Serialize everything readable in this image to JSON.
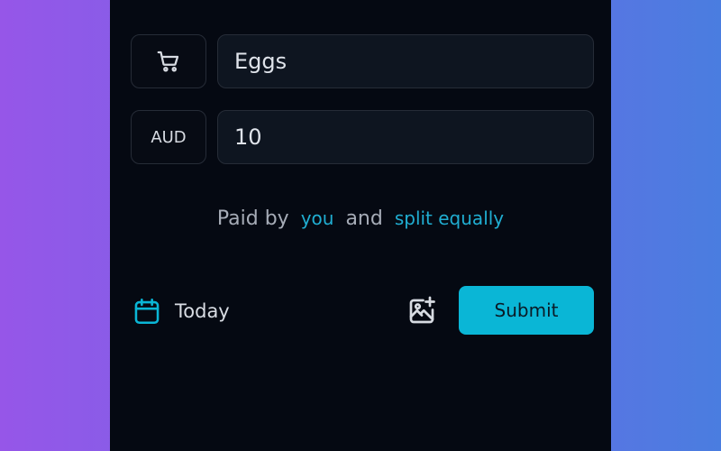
{
  "expense_form": {
    "category_icon": "shopping-cart-icon",
    "description_value": "Eggs",
    "currency_label": "AUD",
    "amount_value": "10"
  },
  "split_summary": {
    "prefix": "Paid by",
    "payer": "you",
    "conjunction": "and",
    "split_method": "split equally"
  },
  "footer": {
    "date_icon": "calendar-icon",
    "date_label": "Today",
    "photo_icon": "add-photo-icon",
    "submit_label": "Submit"
  },
  "colors": {
    "accent": "#0ab6d6",
    "link": "#20aed2",
    "panel_bg": "#050912",
    "field_bg": "#0e1520"
  }
}
